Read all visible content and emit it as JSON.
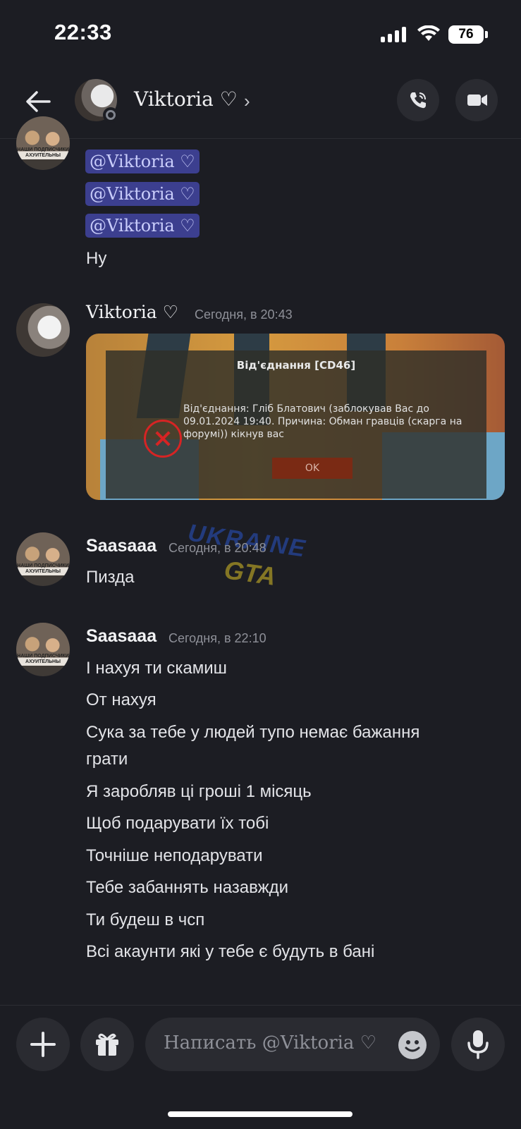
{
  "status": {
    "time": "22:33",
    "battery": "76"
  },
  "header": {
    "name": "Viktoria ♡",
    "chevron": "›"
  },
  "messages_top": {
    "mentions": [
      "@Viktoria ♡",
      "@Viktoria ♡",
      "@Viktoria ♡"
    ],
    "text": "Ну"
  },
  "msg_viktoria": {
    "author": "Viktoria ♡",
    "time": "Сегодня, в 20:43",
    "attachment": {
      "title": "Від'єднання [CD46]",
      "body": "Від'єднання: Гліб Блатович (заблокував Вас до 09.01.2024 19:40. Причина: Обман гравців (скарга на форумі)) кікнув вас",
      "ok": "OK"
    }
  },
  "msg_saasaaa_1": {
    "author": "Saasaaa",
    "time": "Сегодня, в 20:48",
    "lines": [
      "Пизда"
    ]
  },
  "msg_saasaaa_2": {
    "author": "Saasaaa",
    "time": "Сегодня, в 22:10",
    "lines": [
      "І нахуя ти скамиш",
      "От нахуя",
      "Сука за тебе у людей тупо немає бажання",
      "грати",
      "Я заробляв ці гроші 1 місяць",
      "Щоб подарувати їх тобі",
      "Точніше неподарувати",
      "Тебе забаннять назавжди",
      "Ти будеш в чсп",
      "Всі акаунти які у тебе є будуть в бані"
    ]
  },
  "avatar_caption": "НАШИ ПОДПИСЧИКИ АХУИТЕЛЬНЫ",
  "watermark": {
    "line1": "UKRAINE",
    "line2": "GTA"
  },
  "composer": {
    "placeholder": "Написать @Viktoria ♡"
  },
  "colors": {
    "background": "#1c1d23",
    "mention_bg": "#3c3f8f",
    "mention_text": "#c9cdfb"
  }
}
